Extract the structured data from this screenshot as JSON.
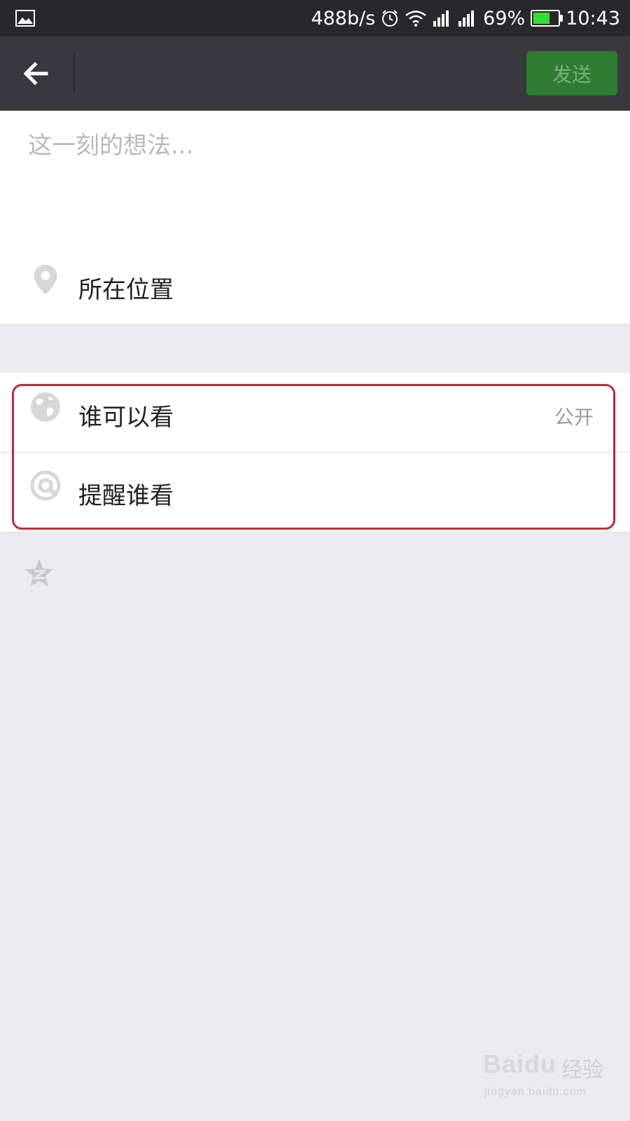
{
  "status_bar": {
    "net_speed": "488b/s",
    "battery_percent": "69%",
    "battery_level": 0.69,
    "time": "10:43",
    "icons": [
      "gallery-icon",
      "alarm-icon",
      "wifi-icon",
      "signal-icon",
      "signal-icon",
      "battery-icon"
    ]
  },
  "top_bar": {
    "back_icon": "arrow-left-icon",
    "send_label": "发送",
    "send_color": "#2e7d32"
  },
  "compose": {
    "placeholder": "这一刻的想法...",
    "value": ""
  },
  "location": {
    "icon": "location-pin-icon",
    "label": "所在位置"
  },
  "visibility": {
    "icon": "globe-icon",
    "label": "谁可以看",
    "value": "公开"
  },
  "mention": {
    "icon": "at-icon",
    "label": "提醒谁看"
  },
  "qzone": {
    "icon": "qzone-star-icon"
  },
  "watermark": {
    "logo_text": "Baidu",
    "cn_text": "经验",
    "url": "jingyan.baidu.com"
  },
  "colors": {
    "status_bar_bg": "#28282c",
    "top_bar_bg": "#38383e",
    "page_bg": "#ebebef",
    "highlight": "#c8283a"
  }
}
